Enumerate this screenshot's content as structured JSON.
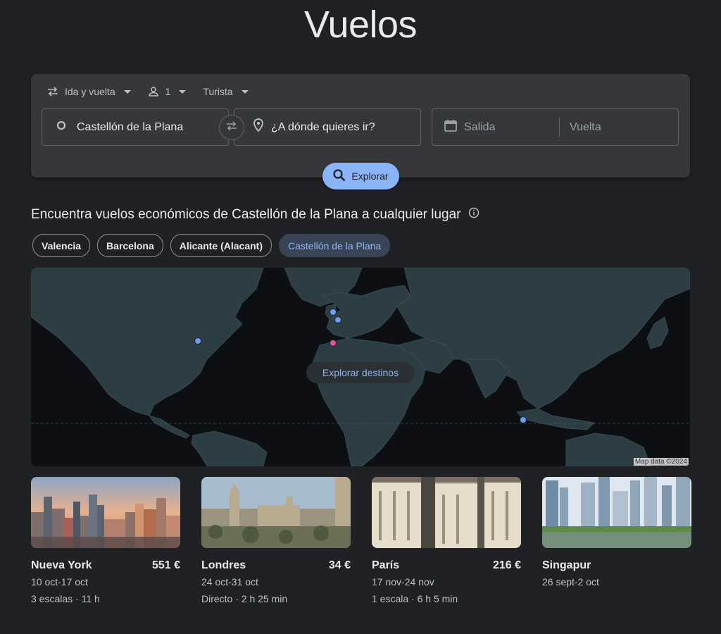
{
  "page": {
    "title": "Vuelos"
  },
  "search": {
    "trip_type": "Ida y vuelta",
    "passengers": "1",
    "cabin": "Turista",
    "origin": "Castellón de la Plana",
    "destination_placeholder": "¿A dónde quieres ir?",
    "departure_placeholder": "Salida",
    "return_placeholder": "Vuelta",
    "explore_label": "Explorar"
  },
  "section": {
    "title": "Encuentra vuelos económicos de Castellón de la Plana a cualquier lugar",
    "chips": [
      "Valencia",
      "Barcelona",
      "Alicante (Alacant)",
      "Castellón de la Plana"
    ],
    "active_chip": "Castellón de la Plana"
  },
  "map": {
    "cta": "Explorar destinos",
    "attribution": "Map data ©2024",
    "colors": {
      "land": "#2c3e43",
      "water": "#0d0f12",
      "dest_dot": "#6c9cf2",
      "origin_dot": "#e2539e"
    }
  },
  "destinations": [
    {
      "city": "Nueva York",
      "price": "551 €",
      "dates": "10 oct-17 oct",
      "details": "3 escalas · 11 h"
    },
    {
      "city": "Londres",
      "price": "34 €",
      "dates": "24 oct-31 oct",
      "details": "Directo · 2 h 25 min"
    },
    {
      "city": "París",
      "price": "216 €",
      "dates": "17 nov-24 nov",
      "details": "1 escala · 6 h 5 min"
    },
    {
      "city": "Singapur",
      "price": "",
      "dates": "26 sept-2 oct",
      "details": ""
    }
  ]
}
